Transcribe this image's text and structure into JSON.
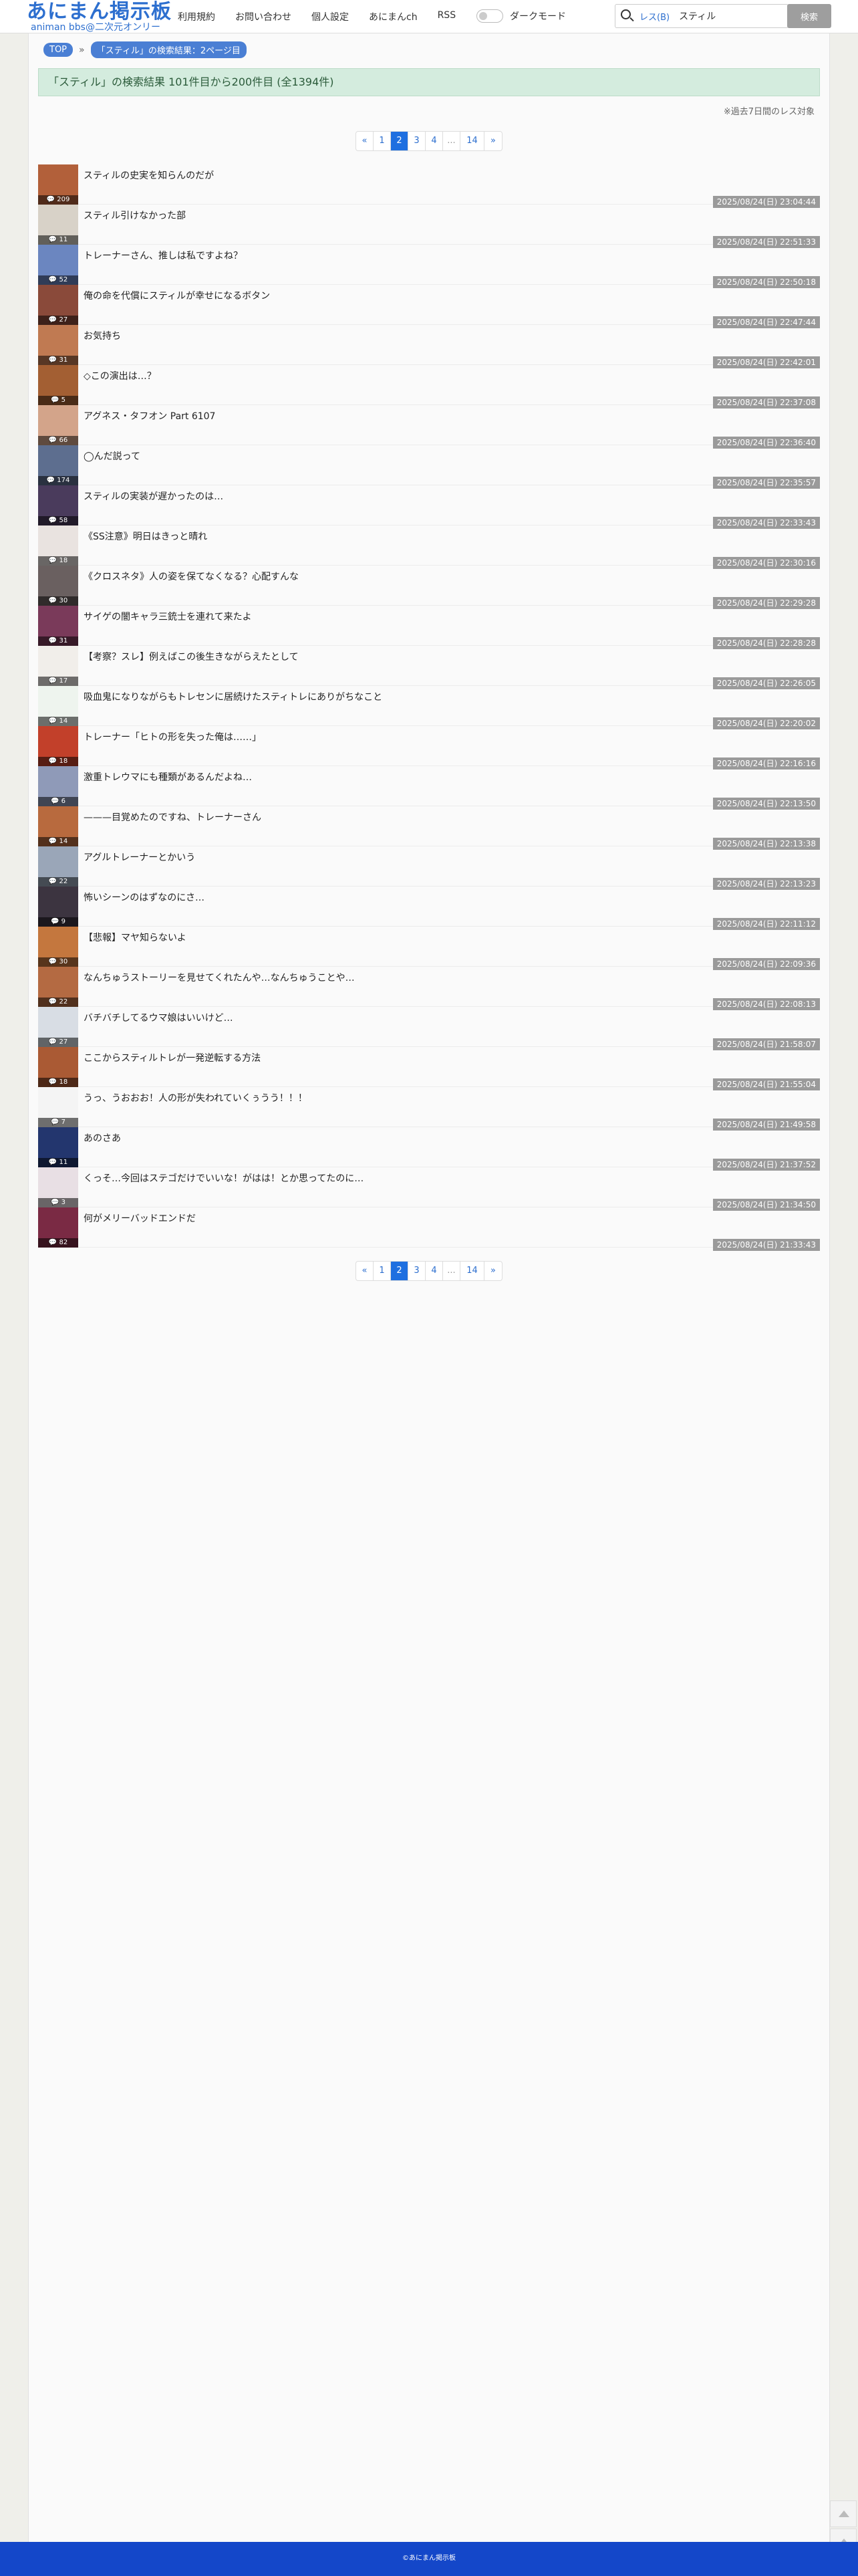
{
  "header": {
    "logo_main": "あにまん掲示板",
    "logo_sub": "animan bbs@二次元オンリー",
    "nav": [
      "利用規約",
      "お問い合わせ",
      "個人設定",
      "あにまんch",
      "RSS"
    ],
    "dark_mode_label": "ダークモード",
    "search_scope": "レス(B)",
    "search_value": "スティル",
    "search_button": "検索"
  },
  "breadcrumb": {
    "top": "TOP",
    "sep": "»",
    "current": "「スティル」の検索結果：2ページ目"
  },
  "result_banner": "「スティル」の検索結果 101件目から200件目 (全1394件)",
  "note": "※過去7日間のレス対象",
  "pagination": {
    "prev": "«",
    "pages": [
      "1",
      "2",
      "3",
      "4"
    ],
    "ellipsis": "...",
    "last": "14",
    "next": "»",
    "current": "2"
  },
  "colors": {
    "accent": "#1e6fe0",
    "footer": "#1447c9",
    "banner": "#d4ecde"
  },
  "threads": [
    {
      "title": "スティルの史実を知らんのだが",
      "count": "209",
      "date": "2025/08/24(日) 23:04:44",
      "thumb_color": "#b2603a"
    },
    {
      "title": "スティル引けなかった部",
      "count": "11",
      "date": "2025/08/24(日) 22:51:33",
      "thumb_color": "#d8d2c8"
    },
    {
      "title": "トレーナーさん、推しは私ですよね？",
      "count": "52",
      "date": "2025/08/24(日) 22:50:18",
      "thumb_color": "#6b86c0"
    },
    {
      "title": "俺の命を代償にスティルが幸せになるボタン",
      "count": "27",
      "date": "2025/08/24(日) 22:47:44",
      "thumb_color": "#8a4a3a"
    },
    {
      "title": "お気持ち",
      "count": "31",
      "date": "2025/08/24(日) 22:42:01",
      "thumb_color": "#c07a52"
    },
    {
      "title": "◇この演出は…？",
      "count": "5",
      "date": "2025/08/24(日) 22:37:08",
      "thumb_color": "#a35f33"
    },
    {
      "title": "アグネス・タフオン Part 6107",
      "count": "66",
      "date": "2025/08/24(日) 22:36:40",
      "thumb_color": "#d3a48a"
    },
    {
      "title": "◯んだ説って",
      "count": "174",
      "date": "2025/08/24(日) 22:35:57",
      "thumb_color": "#5d6e8f"
    },
    {
      "title": "スティルの実装が遅かったのは…",
      "count": "58",
      "date": "2025/08/24(日) 22:33:43",
      "thumb_color": "#4a3b5c"
    },
    {
      "title": "《SS注意》明日はきっと晴れ",
      "count": "18",
      "date": "2025/08/24(日) 22:30:16",
      "thumb_color": "#e9e3e0"
    },
    {
      "title": "《クロスネタ》人の姿を保てなくなる？心配すんな",
      "count": "30",
      "date": "2025/08/24(日) 22:29:28",
      "thumb_color": "#6a6060"
    },
    {
      "title": "サイゲの闇キャラ三銃士を連れて来たよ",
      "count": "31",
      "date": "2025/08/24(日) 22:28:28",
      "thumb_color": "#7a3a5a"
    },
    {
      "title": "【考察？スレ】例えばこの後生きながらえたとして",
      "count": "17",
      "date": "2025/08/24(日) 22:26:05",
      "thumb_color": "#f1eeea"
    },
    {
      "title": "吸血鬼になりながらもトレセンに居続けたスティトレにありがちなこと",
      "count": "14",
      "date": "2025/08/24(日) 22:20:02",
      "thumb_color": "#eef4ee"
    },
    {
      "title": "トレーナー「ヒトの形を失った俺は……」",
      "count": "18",
      "date": "2025/08/24(日) 22:16:16",
      "thumb_color": "#c2402a"
    },
    {
      "title": "激重トレウマにも種類があるんだよね…",
      "count": "6",
      "date": "2025/08/24(日) 22:13:50",
      "thumb_color": "#8f9ab8"
    },
    {
      "title": "———目覚めたのですね、トレーナーさん",
      "count": "14",
      "date": "2025/08/24(日) 22:13:38",
      "thumb_color": "#b86a3e"
    },
    {
      "title": "アグルトレーナーとかいう",
      "count": "22",
      "date": "2025/08/24(日) 22:13:23",
      "thumb_color": "#9aa6b8"
    },
    {
      "title": "怖いシーンのはずなのにさ…",
      "count": "9",
      "date": "2025/08/24(日) 22:11:12",
      "thumb_color": "#3c3440"
    },
    {
      "title": "【悲報】マヤ知らないよ",
      "count": "30",
      "date": "2025/08/24(日) 22:09:36",
      "thumb_color": "#c4773e"
    },
    {
      "title": "なんちゅうストーリーを見せてくれたんや…なんちゅうことや…",
      "count": "22",
      "date": "2025/08/24(日) 22:08:13",
      "thumb_color": "#b46a42"
    },
    {
      "title": "バチバチしてるウマ娘はいいけど…",
      "count": "27",
      "date": "2025/08/24(日) 21:58:07",
      "thumb_color": "#d8dde4"
    },
    {
      "title": "ここからスティルトレが一発逆転する方法",
      "count": "18",
      "date": "2025/08/24(日) 21:55:04",
      "thumb_color": "#aa5a34"
    },
    {
      "title": "うっ、うおおお！人の形が失われていくぅうう！！！",
      "count": "7",
      "date": "2025/08/24(日) 21:49:58",
      "thumb_color": "#f4f4f4"
    },
    {
      "title": "あのさあ",
      "count": "11",
      "date": "2025/08/24(日) 21:37:52",
      "thumb_color": "#23366e"
    },
    {
      "title": "くっそ…今回はステゴだけでいいな！がはは！とか思ってたのに…",
      "count": "3",
      "date": "2025/08/24(日) 21:34:50",
      "thumb_color": "#e8dfe4"
    },
    {
      "title": "何がメリーバッドエンドだ",
      "count": "82",
      "date": "2025/08/24(日) 21:33:43",
      "thumb_color": "#7a2a44"
    }
  ],
  "footer": "©あにまん掲示板"
}
